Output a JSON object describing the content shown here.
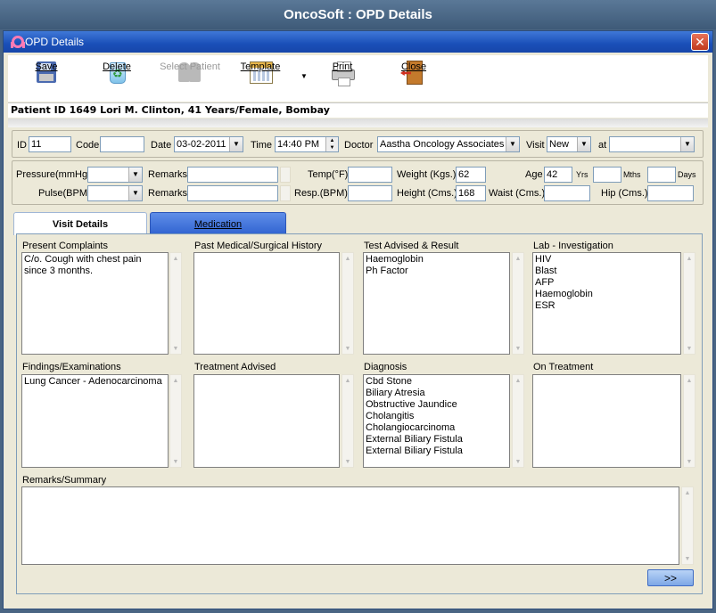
{
  "app_title": "OncoSoft : OPD Details",
  "window": {
    "title": "OPD Details",
    "close": "✕"
  },
  "toolbar": {
    "save": "Save",
    "delete": "Delete",
    "select_patient": "Select Patient",
    "template": "Template",
    "template_arrow": "▼",
    "print": "Print",
    "close": "Close"
  },
  "patient_banner": "Patient ID 1649 Lori M. Clinton, 41 Years/Female, Bombay",
  "visit_row": {
    "id_label": "ID",
    "id_value": "11",
    "code_label": "Code",
    "code_value": "",
    "date_label": "Date",
    "date_value": "03-02-2011",
    "time_label": "Time",
    "time_value": "14:40 PM",
    "doctor_label": "Doctor",
    "doctor_value": "Aastha Oncology Associates",
    "visit_label": "Visit",
    "visit_value": "New",
    "at_label": "at",
    "at_value": ""
  },
  "vitals": {
    "pressure_label": "Pressure(mmHg)",
    "pressure_value": "",
    "pulse_label": "Pulse(BPM)",
    "pulse_value": "",
    "remarks_label": "Remarks",
    "remarks1_value": "",
    "remarks2_value": "",
    "temp_label": "Temp(°F)",
    "temp_value": "",
    "resp_label": "Resp.(BPM)",
    "resp_value": "",
    "weight_label": "Weight (Kgs.)",
    "weight_value": "62",
    "height_label": "Height (Cms.)",
    "height_value": "168",
    "waist_label": "Waist (Cms.)",
    "waist_value": "",
    "age_label": "Age",
    "age_value": "42",
    "yrs_label": "Yrs",
    "mths_label": "Mths",
    "days_label": "Days",
    "mths_value": "",
    "days_value": "",
    "hip_label": "Hip (Cms.)",
    "hip_value": ""
  },
  "tabs": {
    "visit_details": "Visit Details",
    "medication": "Medication"
  },
  "sections": {
    "present_complaints": {
      "title": "Present Complaints",
      "text": "C/o. Cough with chest pain since 3 months."
    },
    "past_history": {
      "title": "Past Medical/Surgical History",
      "text": ""
    },
    "test_advised": {
      "title": "Test Advised & Result",
      "lines": [
        "Haemoglobin",
        "Ph Factor"
      ]
    },
    "lab_investigation": {
      "title": "Lab - Investigation",
      "lines": [
        "HIV",
        "Blast",
        "AFP",
        "Haemoglobin",
        "ESR"
      ]
    },
    "findings": {
      "title": "Findings/Examinations",
      "text": "Lung Cancer - Adenocarcinoma"
    },
    "treatment_advised": {
      "title": "Treatment Advised",
      "text": ""
    },
    "diagnosis": {
      "title": "Diagnosis",
      "lines": [
        "Cbd Stone",
        "Biliary Atresia",
        "Obstructive Jaundice",
        "Cholangitis",
        "Cholangiocarcinoma",
        "External Biliary Fistula",
        "External Biliary Fistula"
      ]
    },
    "on_treatment": {
      "title": "On Treatment",
      "text": ""
    },
    "remarks_summary": {
      "title": "Remarks/Summary",
      "text": ""
    }
  },
  "next_button": ">>",
  "icons": {
    "window": "ribbon-icon",
    "save": "floppy-disk-icon",
    "delete": "recycle-bin-icon",
    "select_patient": "users-icon",
    "template": "calendar-template-icon",
    "print": "printer-icon",
    "close": "exit-door-icon"
  }
}
